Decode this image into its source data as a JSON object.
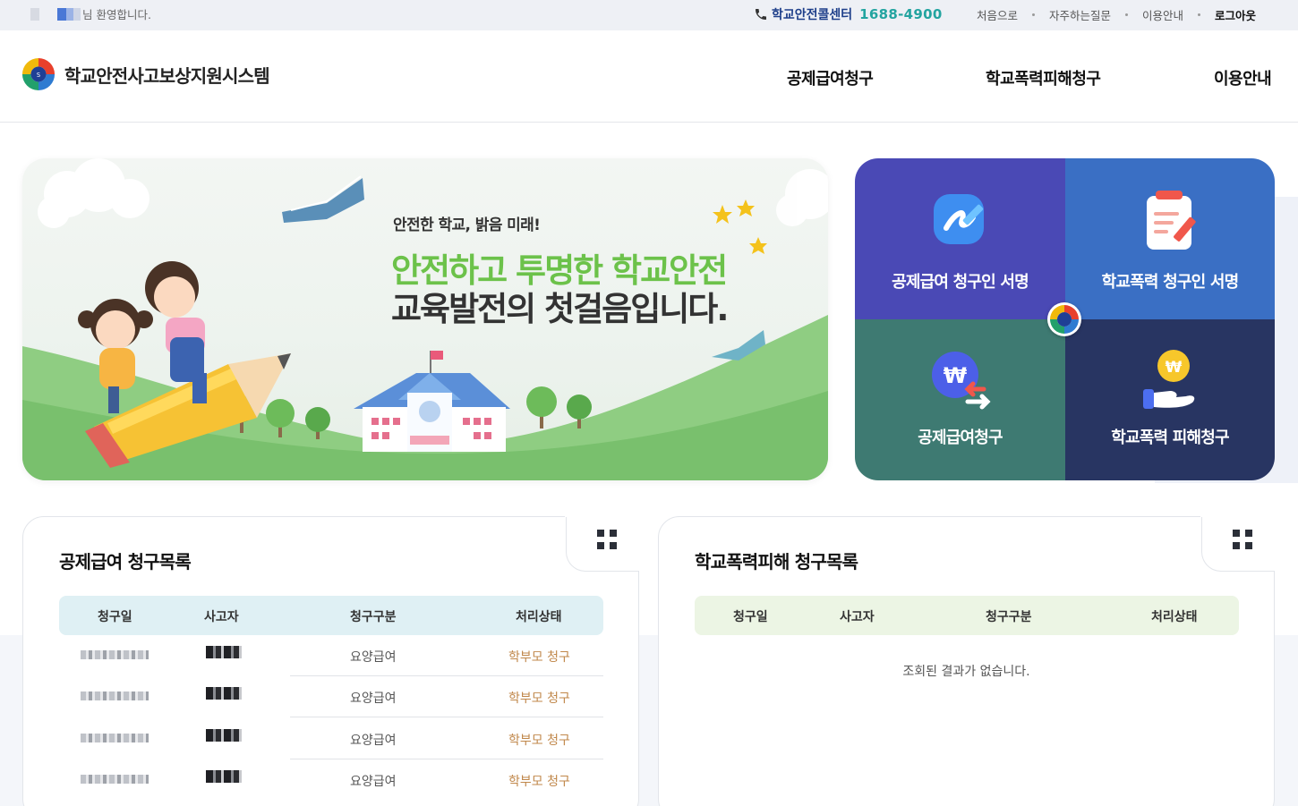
{
  "topbar": {
    "welcome_suffix": "님 환영합니다.",
    "callcenter_label": "학교안전콜센터",
    "callcenter_number": "1688-4900",
    "links": [
      "처음으로",
      "자주하는질문",
      "이용안내",
      "로그아웃"
    ]
  },
  "header": {
    "site_title": "학교안전사고보상지원시스템",
    "nav": [
      "공제급여청구",
      "학교폭력피해청구",
      "이용안내"
    ]
  },
  "hero": {
    "subtitle": "안전한 학교, 밝음 미래!",
    "title_line1": "안전하고 투명한 학교안전",
    "title_line2": "교육발전의 첫걸음입니다."
  },
  "quick_menu": [
    {
      "label": "공제급여 청구인 서명",
      "icon": "pen-icon"
    },
    {
      "label": "학교폭력 청구인 서명",
      "icon": "clipboard-pen-icon"
    },
    {
      "label": "공제급여청구",
      "icon": "won-transfer-icon"
    },
    {
      "label": "학교폭력 피해청구",
      "icon": "won-hand-icon"
    }
  ],
  "claims_list": {
    "title": "공제급여 청구목록",
    "columns": [
      "청구일",
      "사고자",
      "청구구분",
      "처리상태"
    ],
    "rows": [
      {
        "category": "요양급여",
        "status": "학부모 청구"
      },
      {
        "category": "요양급여",
        "status": "학부모 청구"
      },
      {
        "category": "요양급여",
        "status": "학부모 청구"
      },
      {
        "category": "요양급여",
        "status": "학부모 청구"
      }
    ]
  },
  "violence_list": {
    "title": "학교폭력피해 청구목록",
    "columns": [
      "청구일",
      "사고자",
      "청구구분",
      "처리상태"
    ],
    "empty_message": "조회된 결과가 없습니다."
  },
  "colors": {
    "accent_teal": "#23a4a0",
    "navy": "#1e3f8a",
    "hero_green": "#6cc24a",
    "quick_purple": "#4a49b5",
    "quick_blue": "#3a6fc4",
    "quick_teal": "#3e7a72",
    "quick_navy": "#283562",
    "status_brown": "#c0874a"
  }
}
